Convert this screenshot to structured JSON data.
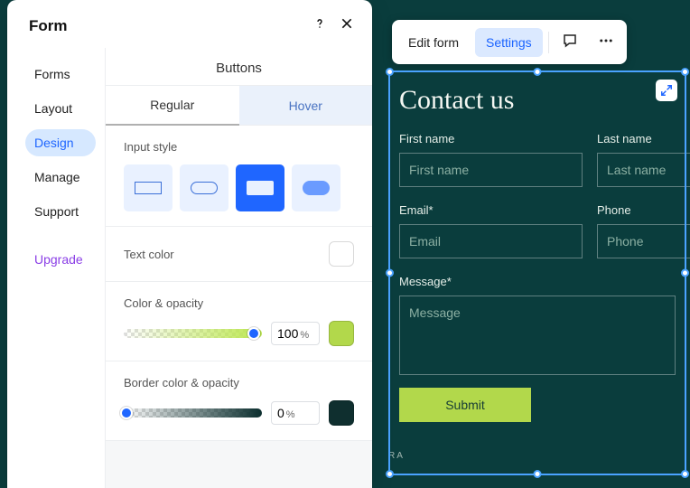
{
  "panel": {
    "title": "Form",
    "nav": [
      "Forms",
      "Layout",
      "Design",
      "Manage",
      "Support"
    ],
    "nav_active_index": 2,
    "upgrade": "Upgrade",
    "section": "Buttons",
    "tabs": {
      "regular": "Regular",
      "hover": "Hover",
      "active_index": 0
    },
    "input_style_label": "Input style",
    "input_style_selected_index": 2,
    "text_color": {
      "label": "Text color",
      "swatch": "#0f2f2f"
    },
    "color_opacity": {
      "label": "Color & opacity",
      "value": "100",
      "unit": "%",
      "swatch": "#b2d84b",
      "slider_pos": 0.94
    },
    "border_opacity": {
      "label": "Border color & opacity",
      "value": "0",
      "unit": "%",
      "swatch": "#0f2f2f",
      "slider_pos": 0.02
    }
  },
  "toolbar": {
    "edit": "Edit form",
    "settings": "Settings"
  },
  "form": {
    "title": "Contact us",
    "fields": {
      "first_name": {
        "label": "First name",
        "placeholder": "First name"
      },
      "last_name": {
        "label": "Last name",
        "placeholder": "Last name"
      },
      "email": {
        "label": "Email*",
        "placeholder": "Email"
      },
      "phone": {
        "label": "Phone",
        "placeholder": "Phone"
      },
      "message": {
        "label": "Message*",
        "placeholder": "Message"
      }
    },
    "submit": "Submit"
  },
  "brand_fragment": "RA"
}
